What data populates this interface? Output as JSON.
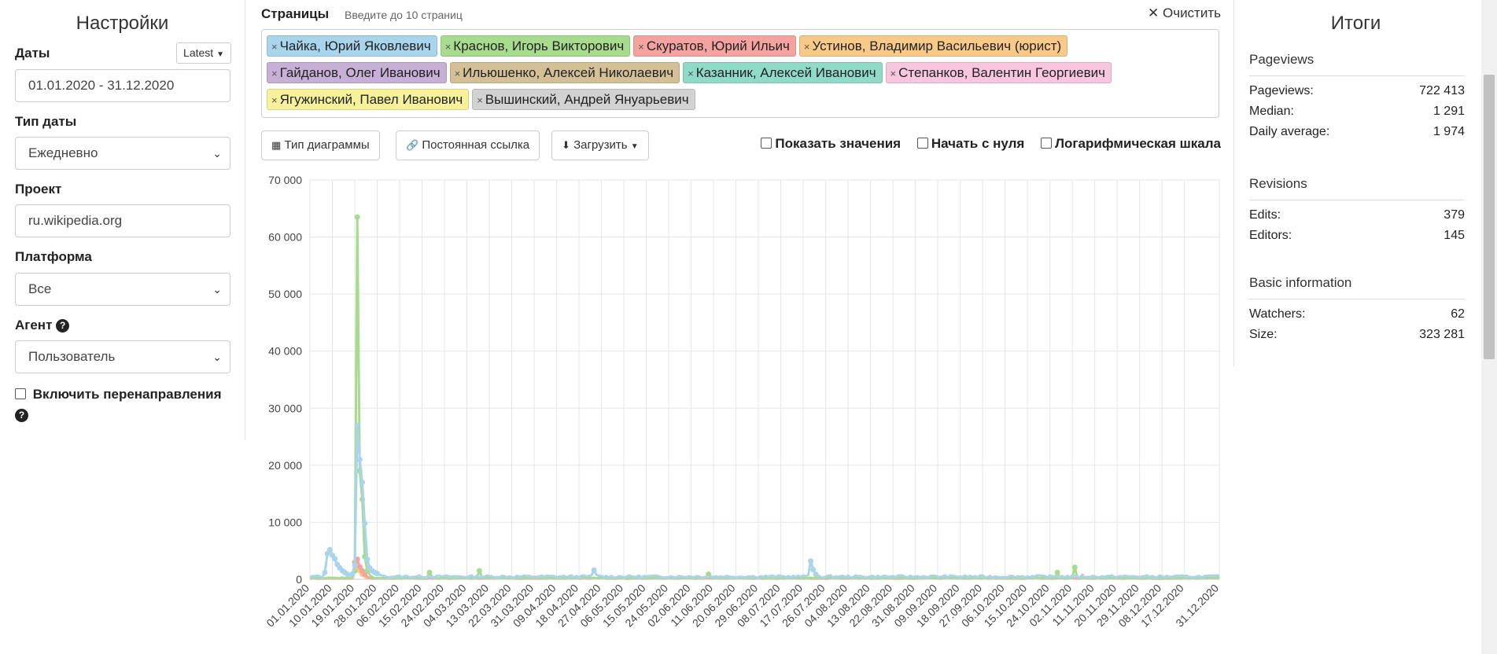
{
  "settings": {
    "title": "Настройки",
    "dates_label": "Даты",
    "latest_label": "Latest",
    "dates_value": "01.01.2020 - 31.12.2020",
    "date_type_label": "Тип даты",
    "date_type_value": "Ежедневно",
    "project_label": "Проект",
    "project_value": "ru.wikipedia.org",
    "platform_label": "Платформа",
    "platform_value": "Все",
    "agent_label": "Агент",
    "agent_value": "Пользователь",
    "redirects_label": "Включить перенаправления"
  },
  "pages": {
    "title": "Страницы",
    "hint": "Введите до 10 страниц",
    "clear_label": "Очистить",
    "tags": [
      {
        "label": "Чайка, Юрий Яковлевич",
        "color": "#a8d4ec"
      },
      {
        "label": "Краснов, Игорь Викторович",
        "color": "#a7dc8f"
      },
      {
        "label": "Скуратов, Юрий Ильич",
        "color": "#f4a3a0"
      },
      {
        "label": "Устинов, Владимир Васильевич (юрист)",
        "color": "#f9c987"
      },
      {
        "label": "Гайданов, Олег Иванович",
        "color": "#c7afd6"
      },
      {
        "label": "Ильюшенко, Алексей Николаевич",
        "color": "#d4c096"
      },
      {
        "label": "Казанник, Алексей Иванович",
        "color": "#90dac8"
      },
      {
        "label": "Степанков, Валентин Георгиевич",
        "color": "#f8c6df"
      },
      {
        "label": "Ягужинский, Павел Иванович",
        "color": "#f7f29a"
      },
      {
        "label": "Вышинский, Андрей Януарьевич",
        "color": "#d2d2d2"
      }
    ]
  },
  "toolbar": {
    "chart_type_label": "Тип диаграммы",
    "permalink_label": "Постоянная ссылка",
    "download_label": "Загрузить",
    "show_values_label": "Показать значения",
    "begin_zero_label": "Начать с нуля",
    "log_scale_label": "Логарифмическая шкала"
  },
  "totals": {
    "title": "Итоги",
    "pageviews_head": "Pageviews",
    "pageviews_rows": [
      {
        "k": "Pageviews:",
        "v": "722 413"
      },
      {
        "k": "Median:",
        "v": "1 291"
      },
      {
        "k": "Daily average:",
        "v": "1 974"
      }
    ],
    "revisions_head": "Revisions",
    "revisions_rows": [
      {
        "k": "Edits:",
        "v": "379"
      },
      {
        "k": "Editors:",
        "v": "145"
      }
    ],
    "basic_head": "Basic information",
    "basic_rows": [
      {
        "k": "Watchers:",
        "v": "62"
      },
      {
        "k": "Size:",
        "v": "323 281"
      }
    ]
  },
  "chart_data": {
    "type": "line",
    "ylim": [
      0,
      70000
    ],
    "y_ticks": [
      "0",
      "10 000",
      "20 000",
      "30 000",
      "40 000",
      "50 000",
      "60 000",
      "70 000"
    ],
    "y_tick_values": [
      0,
      10000,
      20000,
      30000,
      40000,
      50000,
      60000,
      70000
    ],
    "x_range": [
      "2020-01-01",
      "2020-12-31"
    ],
    "x_tick_labels": [
      "01.01.2020",
      "10.01.2020",
      "19.01.2020",
      "28.01.2020",
      "06.02.2020",
      "15.02.2020",
      "24.02.2020",
      "04.03.2020",
      "13.03.2020",
      "22.03.2020",
      "31.03.2020",
      "09.04.2020",
      "18.04.2020",
      "27.04.2020",
      "06.05.2020",
      "15.05.2020",
      "24.05.2020",
      "02.06.2020",
      "11.06.2020",
      "20.06.2020",
      "29.06.2020",
      "08.07.2020",
      "17.07.2020",
      "26.07.2020",
      "04.08.2020",
      "13.08.2020",
      "22.08.2020",
      "31.08.2020",
      "09.09.2020",
      "18.09.2020",
      "27.09.2020",
      "06.10.2020",
      "15.10.2020",
      "24.10.2020",
      "02.11.2020",
      "11.11.2020",
      "20.11.2020",
      "29.11.2020",
      "08.12.2020",
      "17.12.2020",
      "31.12.2020"
    ],
    "x_tick_days": [
      0,
      9,
      18,
      27,
      36,
      45,
      54,
      63,
      72,
      81,
      90,
      99,
      108,
      117,
      126,
      135,
      144,
      153,
      162,
      171,
      180,
      189,
      198,
      207,
      216,
      225,
      234,
      243,
      252,
      261,
      270,
      279,
      288,
      297,
      306,
      315,
      324,
      333,
      342,
      351,
      365
    ],
    "grid": true,
    "legend": "none",
    "series": [
      {
        "name": "Чайка, Юрий Яковлевич",
        "color": "#a8d4ec",
        "baseline": 500,
        "points": [
          [
            0,
            300
          ],
          [
            6,
            1200
          ],
          [
            7,
            4500
          ],
          [
            8,
            5200
          ],
          [
            9,
            4200
          ],
          [
            10,
            3600
          ],
          [
            11,
            2600
          ],
          [
            12,
            2000
          ],
          [
            13,
            1500
          ],
          [
            14,
            1200
          ],
          [
            15,
            900
          ],
          [
            16,
            700
          ],
          [
            17,
            900
          ],
          [
            18,
            2500
          ],
          [
            19,
            27000
          ],
          [
            20,
            21000
          ],
          [
            21,
            17000
          ],
          [
            22,
            9800
          ],
          [
            23,
            3500
          ],
          [
            24,
            2000
          ],
          [
            25,
            1500
          ],
          [
            26,
            1200
          ],
          [
            27,
            1000
          ],
          [
            28,
            800
          ],
          [
            30,
            600
          ],
          [
            113,
            700
          ],
          [
            114,
            1600
          ],
          [
            115,
            800
          ],
          [
            200,
            700
          ],
          [
            201,
            3200
          ],
          [
            202,
            1700
          ],
          [
            203,
            900
          ],
          [
            204,
            700
          ]
        ]
      },
      {
        "name": "Краснов, Игорь Викторович",
        "color": "#a7dc8f",
        "baseline": 250,
        "points": [
          [
            0,
            200
          ],
          [
            17,
            300
          ],
          [
            18,
            1500
          ],
          [
            19,
            63500
          ],
          [
            20,
            19000
          ],
          [
            21,
            14000
          ],
          [
            22,
            4000
          ],
          [
            23,
            1500
          ],
          [
            24,
            800
          ],
          [
            25,
            400
          ],
          [
            48,
            1200
          ],
          [
            49,
            500
          ],
          [
            68,
            1500
          ],
          [
            69,
            400
          ],
          [
            160,
            900
          ],
          [
            161,
            300
          ],
          [
            300,
            1200
          ],
          [
            301,
            300
          ],
          [
            307,
            2100
          ],
          [
            308,
            400
          ]
        ]
      },
      {
        "name": "Скуратов, Юрий Ильич",
        "color": "#f4a3a0",
        "baseline": 150,
        "points": [
          [
            0,
            100
          ],
          [
            17,
            200
          ],
          [
            18,
            3000
          ],
          [
            19,
            3500
          ],
          [
            20,
            2200
          ],
          [
            21,
            1500
          ],
          [
            22,
            900
          ],
          [
            23,
            500
          ],
          [
            24,
            250
          ],
          [
            310,
            800
          ],
          [
            311,
            200
          ]
        ]
      },
      {
        "name": "Устинов, Владимир Васильевич (юрист)",
        "color": "#f9c987",
        "baseline": 120,
        "points": [
          [
            0,
            100
          ],
          [
            18,
            1500
          ],
          [
            19,
            2400
          ],
          [
            20,
            1500
          ],
          [
            21,
            900
          ],
          [
            22,
            400
          ],
          [
            23,
            150
          ]
        ]
      }
    ]
  }
}
